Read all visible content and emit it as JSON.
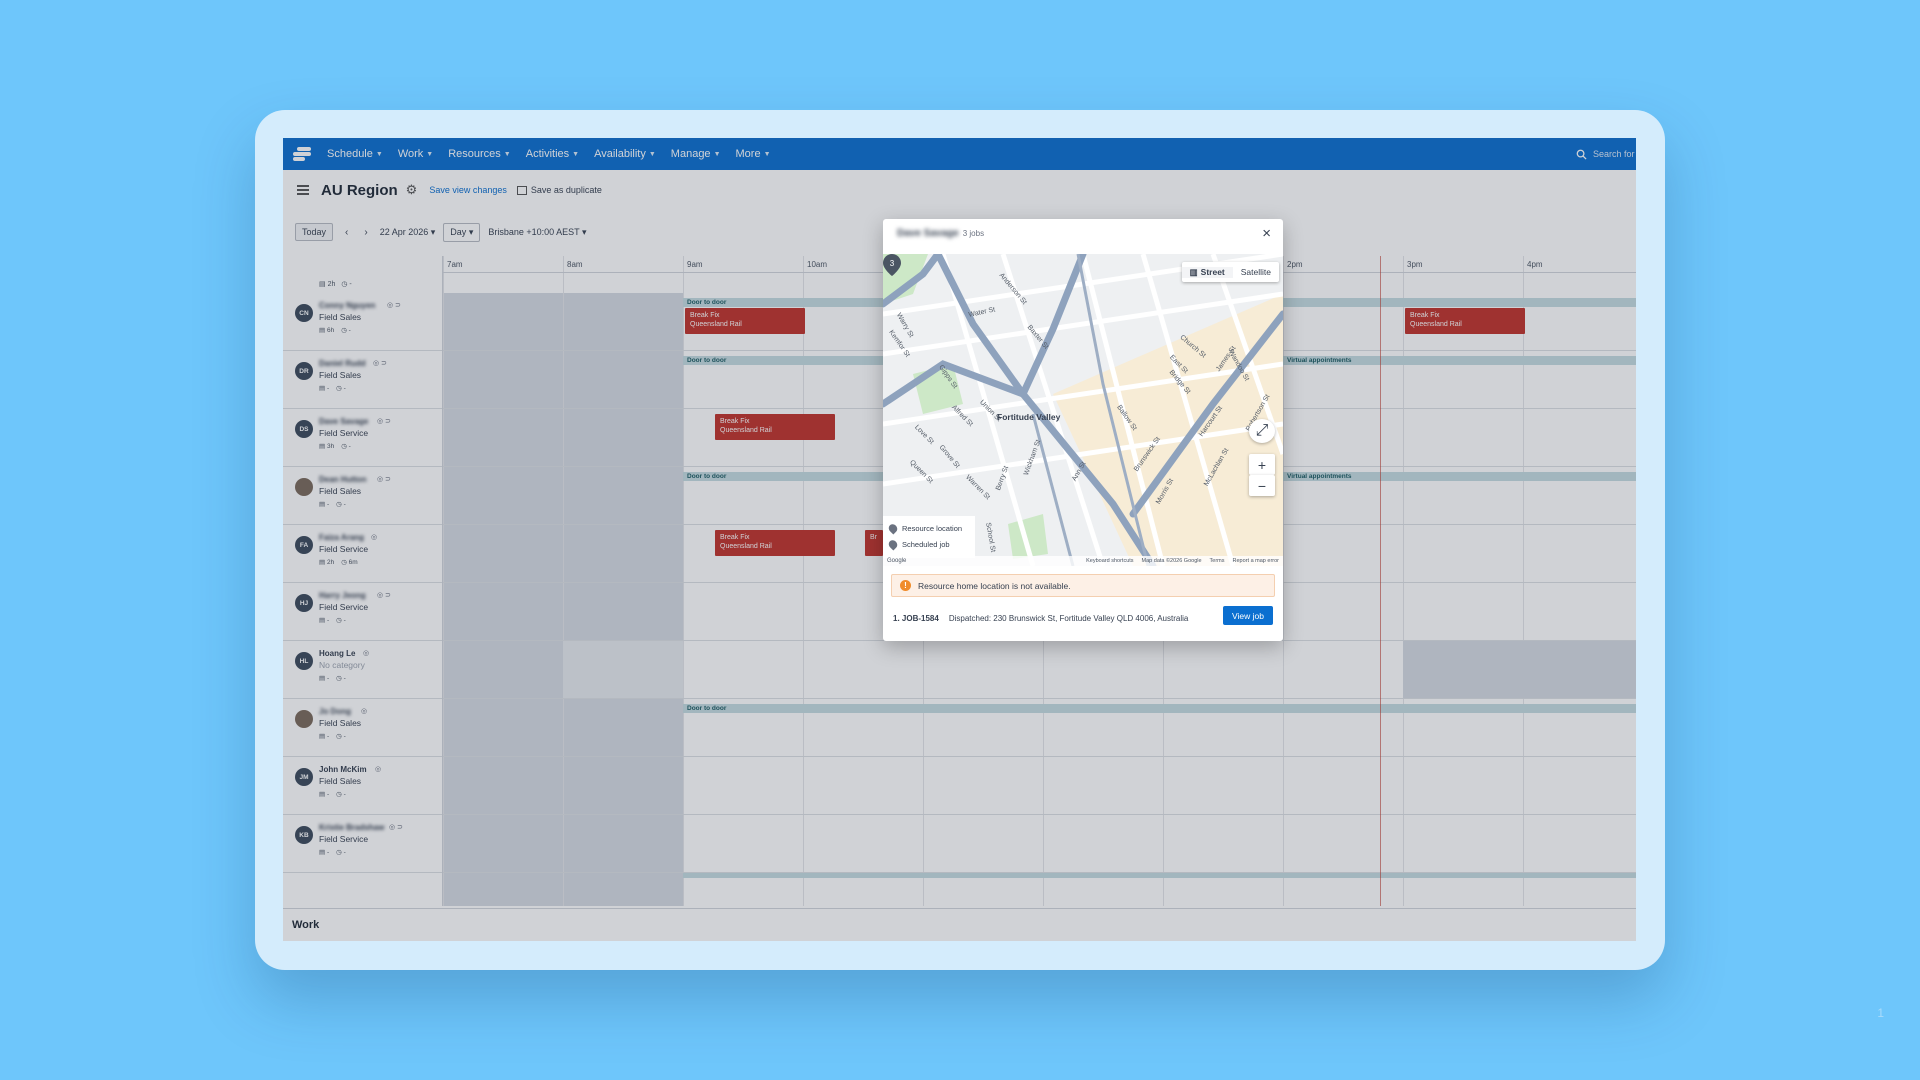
{
  "nav": {
    "items": [
      {
        "label": "Schedule"
      },
      {
        "label": "Work"
      },
      {
        "label": "Resources"
      },
      {
        "label": "Activities"
      },
      {
        "label": "Availability"
      },
      {
        "label": "Manage"
      },
      {
        "label": "More"
      }
    ],
    "search_placeholder": "Search for"
  },
  "header": {
    "title": "AU Region",
    "save_view": "Save view changes",
    "save_duplicate": "Save as duplicate"
  },
  "toolbar": {
    "today": "Today",
    "prev": "‹",
    "next": "›",
    "date": "22 Apr 2026",
    "view": "Day",
    "timezone": "Brisbane +10:00 AEST"
  },
  "hours": [
    "7am",
    "8am",
    "9am",
    "10am",
    "2pm",
    "3pm",
    "4pm"
  ],
  "summary": {
    "hours": "2h",
    "travel": "-"
  },
  "resources": [
    {
      "initials": "CN",
      "name": "Conny Nguyen",
      "category": "Field Sales",
      "hours": "6h",
      "travel": "-"
    },
    {
      "initials": "DR",
      "name": "Daniel Rudd",
      "category": "Field Sales",
      "hours": "-",
      "travel": "-"
    },
    {
      "initials": "DS",
      "name": "Dave Savage",
      "category": "Field Service",
      "hours": "3h",
      "travel": "-"
    },
    {
      "initials": "",
      "name": "Dean Hutton",
      "category": "Field Sales",
      "hours": "-",
      "travel": "-"
    },
    {
      "initials": "FA",
      "name": "Faiza Arang",
      "category": "Field Service",
      "hours": "2h",
      "travel": "6m"
    },
    {
      "initials": "HJ",
      "name": "Harry Jeong",
      "category": "Field Service",
      "hours": "-",
      "travel": "-"
    },
    {
      "initials": "HL",
      "name": "Hoang Le",
      "category": "No category",
      "hours": "-",
      "travel": "-"
    },
    {
      "initials": "",
      "name": "Jo Dong",
      "category": "Field Sales",
      "hours": "-",
      "travel": "-"
    },
    {
      "initials": "JM",
      "name": "John McKim",
      "category": "Field Sales",
      "hours": "-",
      "travel": "-"
    },
    {
      "initials": "KB",
      "name": "Kristie Bradshaw",
      "category": "Field Service",
      "hours": "-",
      "travel": "-"
    }
  ],
  "bands": {
    "door_to_door": "Door to door",
    "virtual": "Virtual appointments"
  },
  "job_block": {
    "title": "Break Fix",
    "client": "Queensland Rail",
    "partial": "Br"
  },
  "work_panel": {
    "title": "Work"
  },
  "modal": {
    "name": "Dave Savage",
    "count": "3 jobs",
    "close": "×",
    "map_street": "Street",
    "map_satellite": "Satellite",
    "legend_resource": "Resource location",
    "legend_scheduled": "Scheduled job",
    "place_label": "Fortitude Valley",
    "marker_number": "3",
    "zoom_in": "+",
    "zoom_out": "−",
    "attribution": {
      "google": "Google",
      "keyboard": "Keyboard shortcuts",
      "data": "Map data ©2026 Google",
      "terms": "Terms",
      "report": "Report a map error"
    },
    "streets": [
      "Anderson St",
      "Water St",
      "Baxter St",
      "Warry St",
      "Kemfor St",
      "Wickham St",
      "Ann St",
      "Brunswick St",
      "Church St",
      "East St",
      "James St",
      "Wandoo St",
      "Bridge St",
      "Robertson St",
      "Ballow St",
      "Gipps St",
      "Love St",
      "Warren St",
      "Berry St",
      "Queen St",
      "Grove St",
      "Union St",
      "Alfred St",
      "School St",
      "Morris St",
      "McLachlan St",
      "Harcourt St"
    ],
    "alert": "Resource home location is not available.",
    "job_index": "1. JOB-1584",
    "job_address": "Dispatched: 230 Brunswick St, Fortitude Valley QLD 4006, Australia",
    "view_job": "View job"
  },
  "slide_number": "1"
}
